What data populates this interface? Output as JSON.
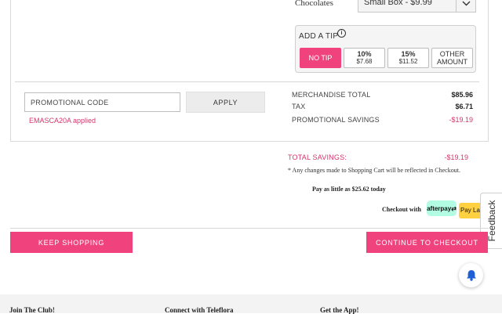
{
  "product": {
    "label": "Chocolates",
    "selected_option": "Small Box - $9.99"
  },
  "tip": {
    "title": "ADD A TIP",
    "options": [
      {
        "label": "NO TIP",
        "amount": "",
        "active": true
      },
      {
        "label": "10%",
        "amount": "$7.68",
        "active": false
      },
      {
        "label": "15%",
        "amount": "$11.52",
        "active": false
      },
      {
        "label": "OTHER AMOUNT",
        "amount": "",
        "active": false
      }
    ]
  },
  "promo": {
    "placeholder": "PROMOTIONAL CODE",
    "value": "",
    "apply_label": "APPLY",
    "applied_message": "EMASCA20A applied"
  },
  "summary": {
    "rows": [
      {
        "label": "MERCHANDISE TOTAL",
        "value": "$85.96"
      },
      {
        "label": "TAX",
        "value": "$6.71"
      },
      {
        "label": "PROMOTIONAL SAVINGS",
        "value": "-$19.19"
      }
    ],
    "total_savings_label": "TOTAL SAVINGS:",
    "total_savings_value": "-$19.19",
    "note": "* Any changes made to Shopping Cart will be reflected in Checkout.",
    "pay_little": "Pay as little as $25.62 today",
    "checkout_with": "Checkout with",
    "afterpay_label": "afterpay",
    "paylater_label": "Pay Later"
  },
  "feedback_label": "Feedback",
  "actions": {
    "keep_shopping": "KEEP SHOPPING",
    "continue_checkout": "CONTINUE TO CHECKOUT"
  },
  "footer": {
    "headings": [
      "Join The Club!",
      "Connect with Teleflora",
      "Get the App!"
    ]
  },
  "colors": {
    "accent": "#f0437d",
    "savings": "#d6336c",
    "afterpay": "#b2fce4",
    "paylater": "#ffd140"
  }
}
